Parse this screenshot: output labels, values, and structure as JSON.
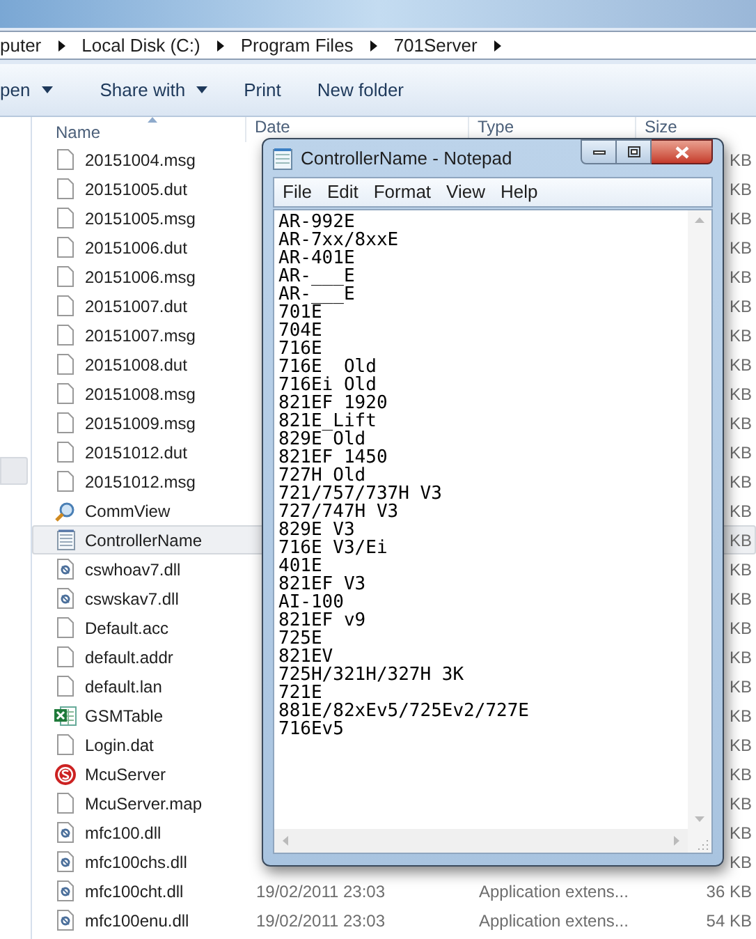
{
  "address_bar": {
    "crumbs": [
      "puter",
      "Local Disk (C:)",
      "Program Files",
      "701Server"
    ]
  },
  "toolbar": [
    {
      "label": "pen",
      "dropdown": true
    },
    {
      "label": "Share with",
      "dropdown": true
    },
    {
      "label": "Print",
      "dropdown": false
    },
    {
      "label": "New folder",
      "dropdown": false
    }
  ],
  "columns": [
    "Name",
    "Date",
    "Type",
    "Size"
  ],
  "files": [
    {
      "name": "20151004.msg",
      "kind": "blank",
      "selected": false,
      "size": "KB"
    },
    {
      "name": "20151005.dut",
      "kind": "blank",
      "selected": false,
      "size": "KB"
    },
    {
      "name": "20151005.msg",
      "kind": "blank",
      "selected": false,
      "size": "KB"
    },
    {
      "name": "20151006.dut",
      "kind": "blank",
      "selected": false,
      "size": "KB"
    },
    {
      "name": "20151006.msg",
      "kind": "blank",
      "selected": false,
      "size": "KB"
    },
    {
      "name": "20151007.dut",
      "kind": "blank",
      "selected": false,
      "size": "KB"
    },
    {
      "name": "20151007.msg",
      "kind": "blank",
      "selected": false,
      "size": "KB"
    },
    {
      "name": "20151008.dut",
      "kind": "blank",
      "selected": false,
      "size": "KB"
    },
    {
      "name": "20151008.msg",
      "kind": "blank",
      "selected": false,
      "size": "KB"
    },
    {
      "name": "20151009.msg",
      "kind": "blank",
      "selected": false,
      "size": "KB"
    },
    {
      "name": "20151012.dut",
      "kind": "blank",
      "selected": false,
      "size": "KB"
    },
    {
      "name": "20151012.msg",
      "kind": "blank",
      "selected": false,
      "size": "KB"
    },
    {
      "name": "CommView",
      "kind": "app",
      "selected": false,
      "size": "KB"
    },
    {
      "name": "ControllerName",
      "kind": "text",
      "selected": true,
      "size": "KB"
    },
    {
      "name": "cswhoav7.dll",
      "kind": "dll",
      "selected": false,
      "size": "KB"
    },
    {
      "name": "cswskav7.dll",
      "kind": "dll",
      "selected": false,
      "size": "KB"
    },
    {
      "name": "Default.acc",
      "kind": "blank",
      "selected": false,
      "size": "KB"
    },
    {
      "name": "default.addr",
      "kind": "blank",
      "selected": false,
      "size": "KB"
    },
    {
      "name": "default.lan",
      "kind": "blank",
      "selected": false,
      "size": "KB"
    },
    {
      "name": "GSMTable",
      "kind": "sheet",
      "selected": false,
      "size": "KB"
    },
    {
      "name": "Login.dat",
      "kind": "blank",
      "selected": false,
      "size": "KB"
    },
    {
      "name": "McuServer",
      "kind": "server",
      "selected": false,
      "size": "KB"
    },
    {
      "name": "McuServer.map",
      "kind": "blank",
      "selected": false,
      "size": "KB"
    },
    {
      "name": "mfc100.dll",
      "kind": "dll",
      "selected": false,
      "size": "KB"
    },
    {
      "name": "mfc100chs.dll",
      "kind": "dll",
      "selected": false,
      "size": "KB"
    },
    {
      "name": "mfc100cht.dll",
      "kind": "dll",
      "selected": false,
      "date": "19/02/2011 23:03",
      "type": "Application extens...",
      "size": "36 KB"
    },
    {
      "name": "mfc100enu.dll",
      "kind": "dll",
      "selected": false,
      "date": "19/02/2011 23:03",
      "type": "Application extens...",
      "size": "54 KB"
    }
  ],
  "notepad": {
    "title": "ControllerName - Notepad",
    "menu": [
      "File",
      "Edit",
      "Format",
      "View",
      "Help"
    ],
    "lines": [
      "AR-992E",
      "AR-7xx/8xxE",
      "AR-401E",
      "AR-___E",
      "AR-___E",
      "701E",
      "704E",
      "716E",
      "716E  Old",
      "716Ei Old",
      "821EF 1920",
      "821E_Lift",
      "829E Old",
      "821EF 1450",
      "727H Old",
      "721/757/737H V3",
      "727/747H V3",
      "829E V3",
      "716E V3/Ei",
      "401E",
      "821EF V3",
      "AI-100",
      "821EF v9",
      "725E",
      "821EV",
      "725H/321H/327H 3K",
      "721E",
      "881E/82xEv5/725Ev2/727E",
      "716Ev5"
    ]
  }
}
